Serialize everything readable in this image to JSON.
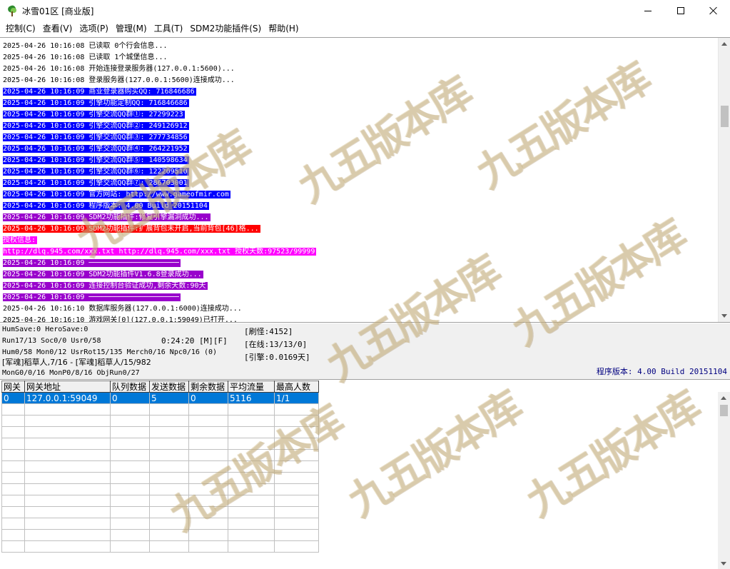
{
  "window": {
    "title": "冰雪01区 [商业版]",
    "icon": "tree-icon"
  },
  "menu": [
    "控制(C)",
    "查看(V)",
    "选项(P)",
    "管理(M)",
    "工具(T)",
    "SDM2功能插件(S)",
    "帮助(H)"
  ],
  "log": [
    {
      "text": "2025-04-26 10:16:08 已读取 0个行会信息...",
      "bg": "",
      "fg": "#000000"
    },
    {
      "text": "2025-04-26 10:16:08 已读取 1个城堡信息...",
      "bg": "",
      "fg": "#000000"
    },
    {
      "text": "2025-04-26 10:16:08 开始连接登录服务器(127.0.0.1:5600)...",
      "bg": "",
      "fg": "#000000"
    },
    {
      "text": "2025-04-26 10:16:08 登录服务器(127.0.0.1:5600)连接成功...",
      "bg": "",
      "fg": "#000000"
    },
    {
      "text": "2025-04-26 10:16:09 商业登录器购买QQ: 716846686",
      "bg": "#0000ff",
      "fg": "#ffffff"
    },
    {
      "text": "2025-04-26 10:16:09 引擎功能定制QQ: 716846686",
      "bg": "#0000ff",
      "fg": "#ffffff"
    },
    {
      "text": "2025-04-26 10:16:09 引擎交流QQ群①: 27299223",
      "bg": "#0000ff",
      "fg": "#ffffff"
    },
    {
      "text": "2025-04-26 10:16:09 引擎交流QQ群②: 249126912",
      "bg": "#0000ff",
      "fg": "#ffffff"
    },
    {
      "text": "2025-04-26 10:16:09 引擎交流QQ群③: 277734856",
      "bg": "#0000ff",
      "fg": "#ffffff"
    },
    {
      "text": "2025-04-26 10:16:09 引擎交流QQ群④: 264221952",
      "bg": "#0000ff",
      "fg": "#ffffff"
    },
    {
      "text": "2025-04-26 10:16:09 引擎交流QQ群⑤: 140598634",
      "bg": "#0000ff",
      "fg": "#ffffff"
    },
    {
      "text": "2025-04-26 10:16:09 引擎交流QQ群⑥: 122209510",
      "bg": "#0000ff",
      "fg": "#ffffff"
    },
    {
      "text": "2025-04-26 10:16:09 引擎交流QQ群⑦: 286703001",
      "bg": "#0000ff",
      "fg": "#ffffff"
    },
    {
      "text": "2025-04-26 10:16:09 官方网站: http://www.gameofmir.com",
      "bg": "#0000ff",
      "fg": "#ffffff"
    },
    {
      "text": "2025-04-26 10:16:09 程序版本: 4.00 Build 20151104",
      "bg": "#0000ff",
      "fg": "#ffffff"
    },
    {
      "text": "2025-04-26 10:16:09 SDM2功能插件:修复引擎漏洞成功...",
      "bg": "#9900cc",
      "fg": "#ffffff"
    },
    {
      "text": "2025-04-26 10:16:09 SDM2功能插件:扩展背包未开启,当前背包[46]格...",
      "bg": "#ff0000",
      "fg": "#ffffff"
    },
    {
      "text": "授权信息:",
      "bg": "#ff00ff",
      "fg": "#ffffff"
    },
    {
      "text": "http://dlq.945.com/xxx.txt http://dlq.945.com/xxx.txt 授权天数:97523/99999",
      "bg": "#ff00ff",
      "fg": "#ffffff"
    },
    {
      "text": "2025-04-26 10:16:09 ─────────────────────",
      "bg": "#9900cc",
      "fg": "#ffffff"
    },
    {
      "text": "2025-04-26 10:16:09 SDM2功能插件V1.6.8登录成功...",
      "bg": "#9900cc",
      "fg": "#ffffff"
    },
    {
      "text": "2025-04-26 10:16:09 连接控制台验证成功,剩余天数:90天",
      "bg": "#9900cc",
      "fg": "#ffffff"
    },
    {
      "text": "2025-04-26 10:16:09 ─────────────────────",
      "bg": "#9900cc",
      "fg": "#ffffff"
    },
    {
      "text": "2025-04-26 10:16:10 数据库服务器(127.0.0.1:6000)连接成功...",
      "bg": "",
      "fg": "#000000"
    },
    {
      "text": "2025-04-26 10:16:10 游戏网关[0](127.0.0.1:59049)已打开...",
      "bg": "",
      "fg": "#000000"
    }
  ],
  "status": {
    "line1": "HumSave:0 HeroSave:0",
    "line2": "Run17/13 Soc0/0 Usr0/58",
    "time": "0:24:20 [M][F]",
    "line3": "Hum0/58 Mon0/12 UsrRot15/135 Merch0/16 Npc0/16 (0)",
    "line4": "[军魂]稻草人,7/16 - [军魂]稻草人/15/982",
    "line5": "MonG0/0/16 MonP0/8/16 ObjRun0/27",
    "right1": "[刷怪:4152]",
    "right2": "[在线:13/13/0]",
    "right3": "[引擎:0.0169天]",
    "version": "程序版本: 4.00 Build 20151104"
  },
  "grid": {
    "headers": [
      "网关",
      "网关地址",
      "队列数据",
      "发送数据",
      "剩余数据",
      "平均流量",
      "最高人数"
    ],
    "rows": [
      [
        "0",
        "127.0.0.1:59049",
        "0",
        "5",
        "0",
        "5116",
        "1/1"
      ]
    ]
  },
  "watermark": "九五版本库"
}
